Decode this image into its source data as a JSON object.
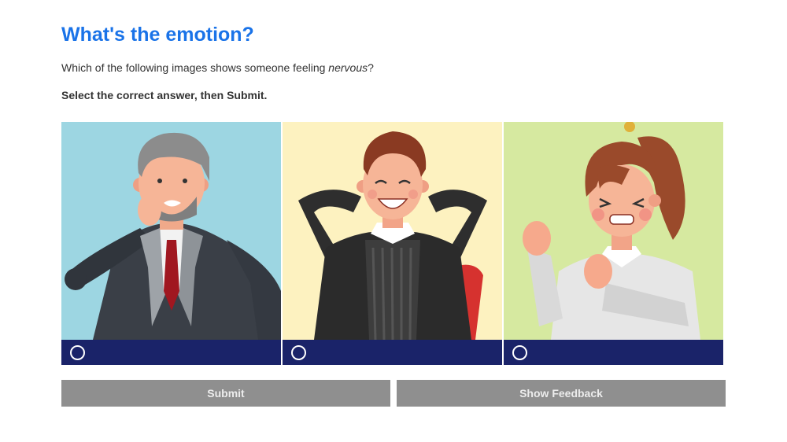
{
  "quiz": {
    "title": "What's the emotion?",
    "question_prefix": "Which of the following images shows someone feeling ",
    "question_emphasis": "nervous",
    "question_suffix": "?",
    "instruction": "Select the correct answer, then Submit.",
    "options": [
      {
        "bg_color": "#9dd6e2",
        "selected": false
      },
      {
        "bg_color": "#fdf2c0",
        "selected": false
      },
      {
        "bg_color": "#d6e9a0",
        "selected": false
      }
    ],
    "submit_label": "Submit",
    "feedback_label": "Show Feedback"
  },
  "colors": {
    "title": "#1a73e8",
    "option_bar": "#1a2369",
    "button": "#8f8f8f"
  }
}
